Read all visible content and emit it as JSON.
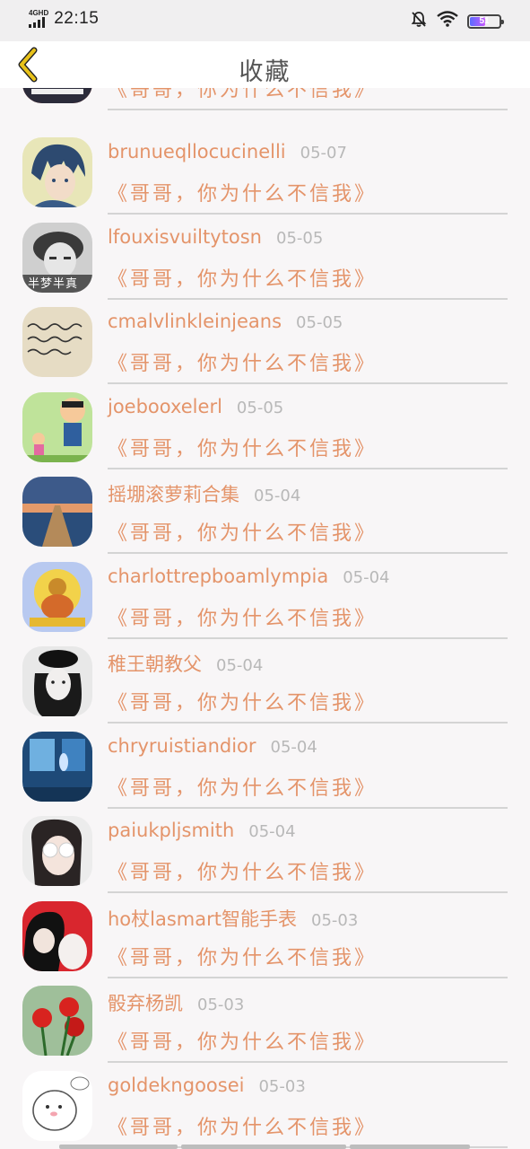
{
  "status_bar": {
    "network": "4GHD",
    "time": "22:15",
    "battery_level": "51",
    "icons": [
      "signal-icon",
      "mute-bell-icon",
      "wifi-icon",
      "battery-icon"
    ]
  },
  "header": {
    "title": "收藏",
    "back_icon": "chevron-left-icon",
    "accent_color": "#e8c21a"
  },
  "colors": {
    "name": "#e4946a",
    "date": "#b8b8b8",
    "quote": "#e4946a",
    "divider": "#d4d4d4"
  },
  "favorites": [
    {
      "name": "",
      "date": "",
      "quote": "《哥哥，你为什么不信我》",
      "avatar": "partial-avatar"
    },
    {
      "name": "brunueqllocucinelli",
      "date": "05-07",
      "quote": "《哥哥，你为什么不信我》",
      "avatar": "anime-boy-avatar"
    },
    {
      "name": "lfouxisvuiltytosn",
      "date": "05-05",
      "quote": "《哥哥，你为什么不信我》",
      "avatar": "grayscale-boy-avatar",
      "avatar_caption": "半梦半真"
    },
    {
      "name": "cmalvlinkleinjeans",
      "date": "05-05",
      "quote": "《哥哥，你为什么不信我》",
      "avatar": "handwriting-note-avatar"
    },
    {
      "name": "joebooxelerl",
      "date": "05-05",
      "quote": "《哥哥，你为什么不信我》",
      "avatar": "cartoon-family-avatar"
    },
    {
      "name": "摇堋滚萝莉合集",
      "date": "05-04",
      "quote": "《哥哥，你为什么不信我》",
      "avatar": "pier-sunset-avatar"
    },
    {
      "name": "charlottrepboamlympia",
      "date": "05-04",
      "quote": "《哥哥，你为什么不信我》",
      "avatar": "buddha-avatar"
    },
    {
      "name": "稚王朝教父",
      "date": "05-04",
      "quote": "《哥哥，你为什么不信我》",
      "avatar": "girl-cap-bw-avatar"
    },
    {
      "name": "chryruistiandior",
      "date": "05-04",
      "quote": "《哥哥，你为什么不信我》",
      "avatar": "blue-room-avatar"
    },
    {
      "name": "paiukpljsmith",
      "date": "05-04",
      "quote": "《哥哥，你为什么不信我》",
      "avatar": "girl-sunglasses-avatar"
    },
    {
      "name": "ho杖lasmart智能手表",
      "date": "05-03",
      "quote": "《哥哥，你为什么不信我》",
      "avatar": "red-anime-avatar"
    },
    {
      "name": "骰弃杨凯",
      "date": "05-03",
      "quote": "《哥哥，你为什么不信我》",
      "avatar": "red-roses-avatar"
    },
    {
      "name": "goldekngoosei",
      "date": "05-03",
      "quote": "《哥哥，你为什么不信我》",
      "avatar": "cartoon-bear-avatar"
    }
  ]
}
